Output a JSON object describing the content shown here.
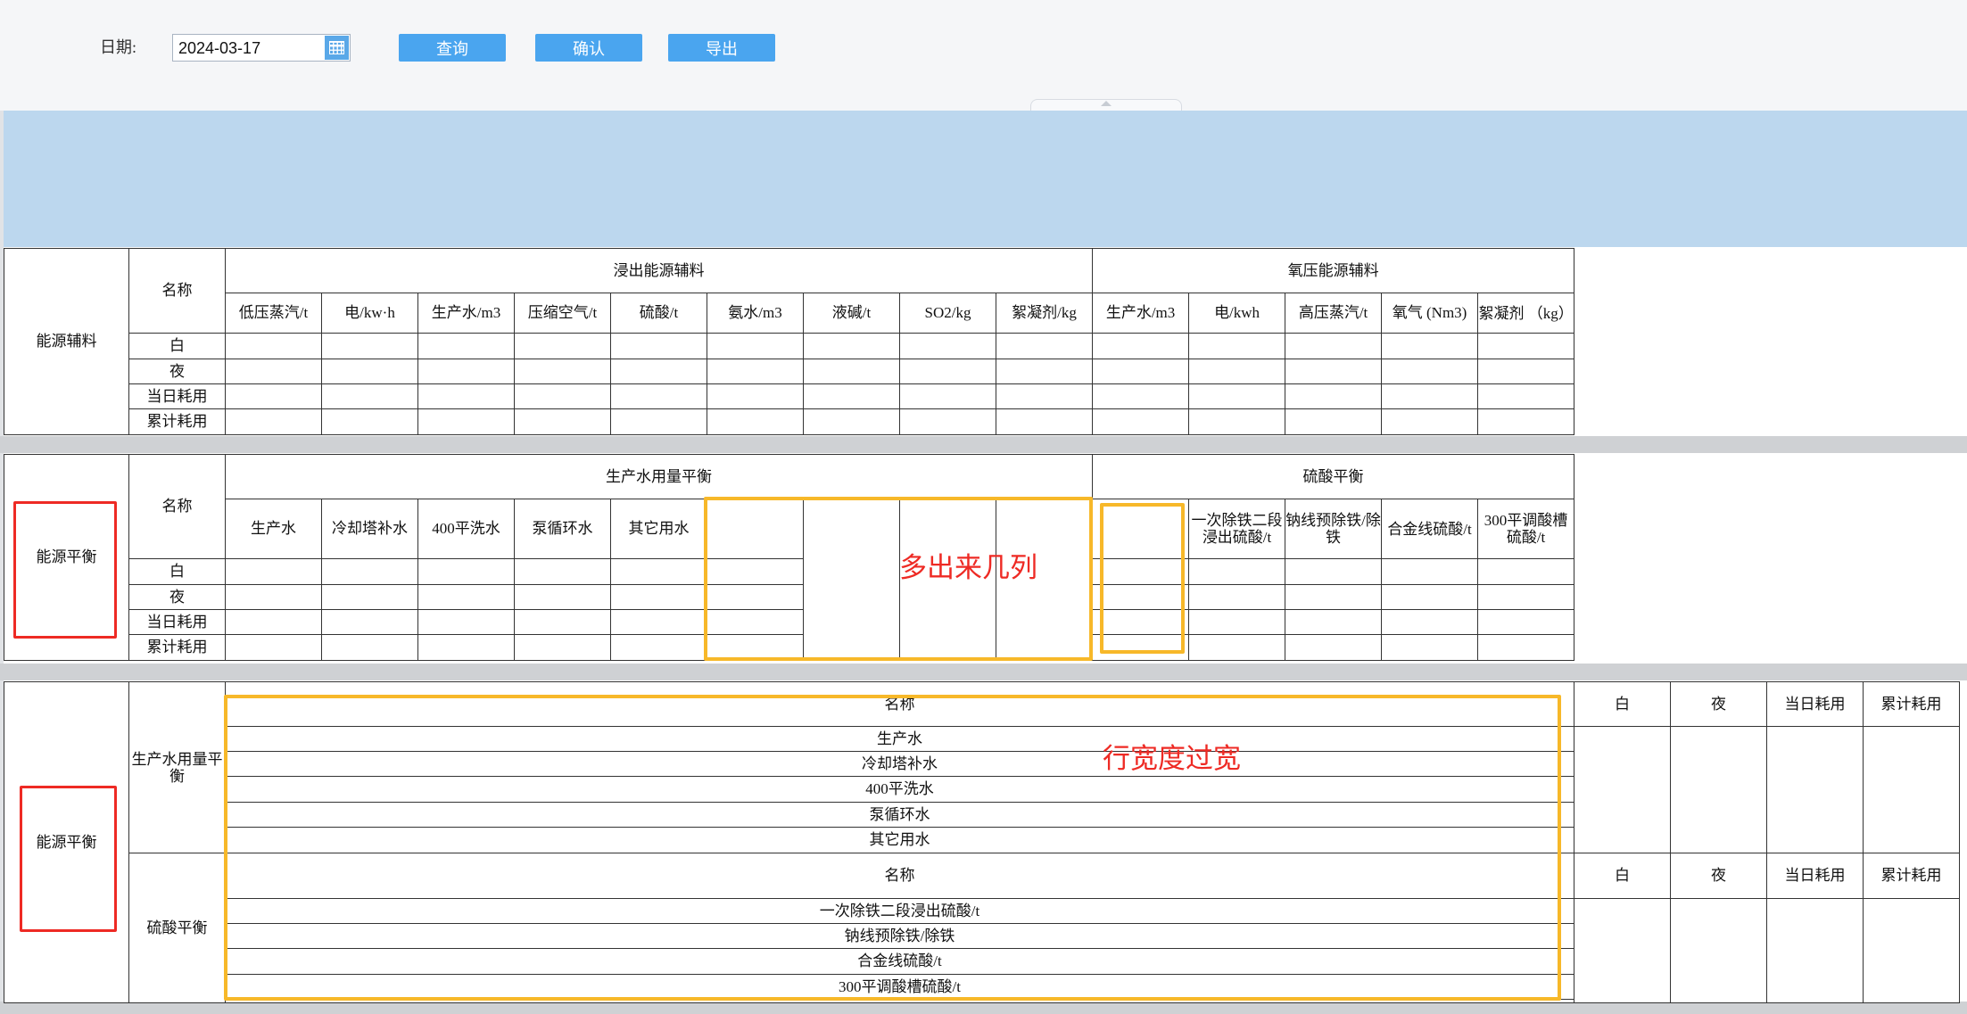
{
  "toolbar": {
    "date_label": "日期:",
    "date_value": "2024-03-17",
    "query_label": "查询",
    "confirm_label": "确认",
    "export_label": "导出"
  },
  "table1": {
    "section_label": "能源辅料",
    "name_header": "名称",
    "group1_label": "浸出能源辅料",
    "group2_label": "氧压能源辅料",
    "columns": [
      "低压蒸汽/t",
      "电/kw·h",
      "生产水/m3",
      "压缩空气/t",
      "硫酸/t",
      "氨水/m3",
      "液碱/t",
      "SO2/kg",
      "絮凝剂/kg",
      "生产水/m3",
      "电/kwh",
      "高压蒸汽/t",
      "氧气 (Nm3)",
      "絮凝剂 （kg）"
    ],
    "rows": [
      "白",
      "夜",
      "当日耗用",
      "累计耗用"
    ]
  },
  "table2": {
    "section_label": "能源平衡",
    "name_header": "名称",
    "group1_label": "生产水用量平衡",
    "group2_label": "硫酸平衡",
    "columns": [
      "生产水",
      "冷却塔补水",
      "400平洗水",
      "泵循环水",
      "其它用水",
      "",
      "",
      "",
      "",
      "",
      "一次除铁二段浸出硫酸/t",
      "钠线预除铁/除铁",
      "合金线硫酸/t",
      "300平调酸槽硫酸/t"
    ],
    "rows": [
      "白",
      "夜",
      "当日耗用",
      "累计耗用"
    ]
  },
  "table3": {
    "section_label": "能源平衡",
    "block1": {
      "group_label": "生产水用量平衡",
      "name_header": "名称",
      "value_headers": [
        "白",
        "夜",
        "当日耗用",
        "累计耗用"
      ],
      "items": [
        "生产水",
        "冷却塔补水",
        "400平洗水",
        "泵循环水",
        "其它用水"
      ]
    },
    "block2": {
      "group_label": "硫酸平衡",
      "name_header": "名称",
      "value_headers": [
        "白",
        "夜",
        "当日耗用",
        "累计耗用"
      ],
      "items": [
        "一次除铁二段浸出硫酸/t",
        "钠线预除铁/除铁",
        "合金线硫酸/t",
        "300平调酸槽硫酸/t"
      ]
    }
  },
  "annotations": {
    "extra_columns_note": "多出来几列",
    "row_width_note": "行宽度过宽",
    "red_color": "#ee2a24",
    "yellow_color": "#f7b829"
  },
  "colors": {
    "button_blue": "#4aa5ef",
    "banner_blue": "#bcd7ee",
    "separator_gray": "#cfd1d4"
  }
}
